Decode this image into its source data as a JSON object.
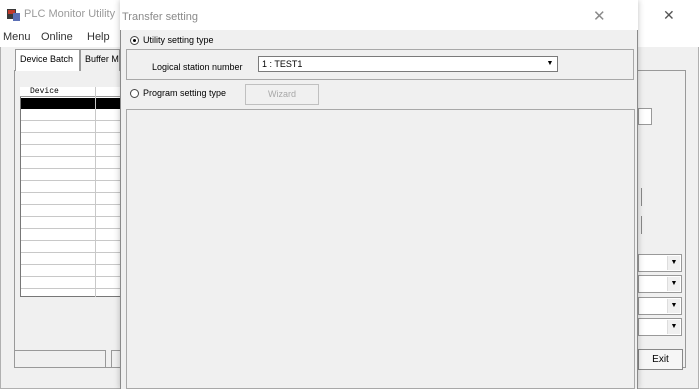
{
  "main_window": {
    "title": "PLC Monitor Utility",
    "close_glyph": "✕",
    "menu": [
      "Menu",
      "Online",
      "Help"
    ],
    "tabs": [
      "Device Batch",
      "Buffer M"
    ],
    "grid": {
      "header": "Device"
    },
    "exit_label": "Exit"
  },
  "dialog": {
    "title": "Transfer setting",
    "close_glyph": "✕",
    "utility_option": "Utility setting type",
    "logical_station_label": "Logical station number",
    "logical_station_value": "1 : TEST1",
    "program_option": "Program setting type",
    "wizard_label": "Wizard",
    "selected_option": "utility"
  },
  "icons": {
    "app": "plc-monitor-app-icon",
    "dropdown": "chevron-down-icon"
  }
}
